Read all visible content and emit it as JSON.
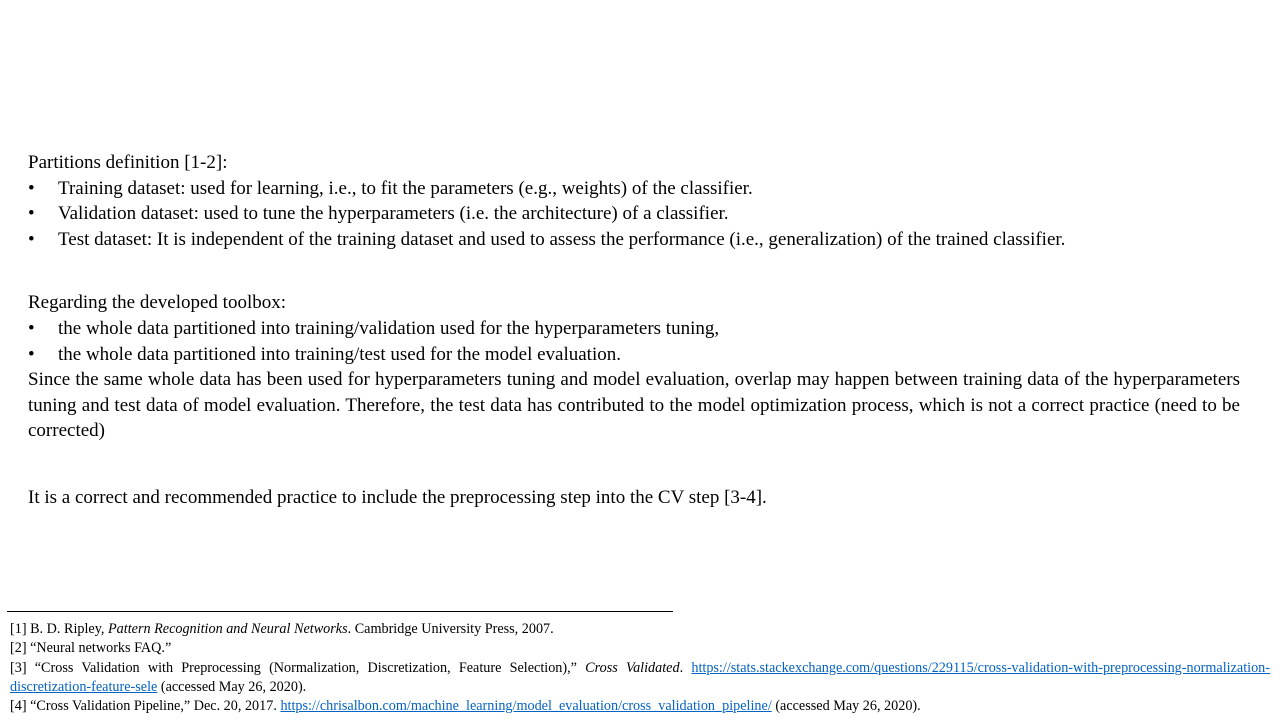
{
  "partitions": {
    "heading": "Partitions definition [1-2]:",
    "items": [
      "Training dataset: used for learning, i.e., to fit the parameters (e.g., weights) of the classifier.",
      "Validation dataset: used to tune the hyperparameters (i.e. the architecture) of a classifier.",
      "Test dataset: It is independent of the training dataset and used to assess the performance (i.e., generalization) of the trained classifier."
    ]
  },
  "toolbox": {
    "heading": "Regarding the developed toolbox:",
    "items": [
      "the whole data partitioned into training/validation used for the hyperparameters tuning,",
      "the whole data partitioned into training/test used for the model evaluation."
    ],
    "paragraph": "Since the same whole data has been used for hyperparameters tuning and model evaluation, overlap may happen between training data of the hyperparameters tuning and test data of model evaluation. Therefore, the test data has contributed to the model optimization process, which is not a correct practice (need to be corrected)"
  },
  "recommendation": "It is a correct and recommended practice to include the preprocessing step into the CV step [3-4].",
  "bullet_symbol": "•",
  "references": [
    {
      "prefix": "[1] B. D. Ripley, ",
      "italic": "Pattern Recognition and Neural Networks",
      "middle": ". Cambridge University Press, 2007.",
      "link": "",
      "suffix": ""
    },
    {
      "prefix": "[2] “Neural networks FAQ.”",
      "italic": "",
      "middle": "",
      "link": "",
      "suffix": ""
    },
    {
      "prefix": "[3] “Cross Validation with Preprocessing (Normalization, Discretization, Feature Selection),” ",
      "italic": "Cross Validated",
      "middle": ". ",
      "link": "https://stats.stackexchange.com/questions/229115/cross-validation-with-preprocessing-normalization-discretization-feature-sele",
      "suffix": " (accessed May 26, 2020)."
    },
    {
      "prefix": "[4] “Cross Validation Pipeline,” Dec. 20, 2017. ",
      "italic": "",
      "middle": "",
      "link": "https://chrisalbon.com/machine_learning/model_evaluation/cross_validation_pipeline/",
      "suffix": " (accessed May 26, 2020)."
    }
  ],
  "colors": {
    "link": "#0563c1",
    "text": "#000000",
    "background": "#ffffff"
  }
}
